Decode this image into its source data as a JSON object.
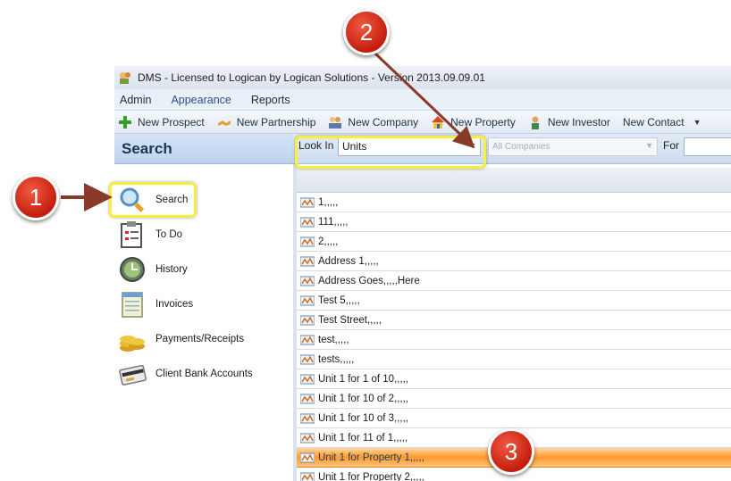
{
  "window": {
    "title": "DMS - Licensed to Logican by Logican Solutions - Version 2013.09.09.01"
  },
  "menu": [
    "Admin",
    "Appearance",
    "Reports"
  ],
  "toolbar": {
    "new_prospect": "New Prospect",
    "new_partnership": "New Partnership",
    "new_company": "New Company",
    "new_property": "New Property",
    "new_investor": "New Investor",
    "new_contact": "New Contact"
  },
  "left_panel": {
    "title": "Search",
    "items": [
      {
        "label": "Search",
        "icon": "magnifier-icon"
      },
      {
        "label": "To Do",
        "icon": "clipboard-icon"
      },
      {
        "label": "History",
        "icon": "clock-icon"
      },
      {
        "label": "Invoices",
        "icon": "notebook-icon"
      },
      {
        "label": "Payments/Receipts",
        "icon": "coins-icon"
      },
      {
        "label": "Client Bank Accounts",
        "icon": "credit-card-icon"
      }
    ]
  },
  "search_bar": {
    "look_in_label": "Look In",
    "look_in_value": "Units",
    "companies_value": "All Companies",
    "for_label": "For"
  },
  "results": [
    "1,,,,,",
    "111,,,,,",
    "2,,,,,",
    "Address 1,,,,,",
    "Address Goes,,,,,Here",
    "Test 5,,,,,",
    "Test Street,,,,,",
    "test,,,,,",
    "tests,,,,,",
    "Unit 1 for 1 of 10,,,,,",
    "Unit 1 for 10 of 2,,,,,",
    "Unit 1 for 10 of 3,,,,,",
    "Unit 1 for 11 of 1,,,,,",
    "Unit 1 for Property 1,,,,,",
    "Unit 1 for Property 2,,,,,"
  ],
  "selected_row": "Unit 1 for Property 1,,,,,",
  "callouts": {
    "one": "1",
    "two": "2",
    "three": "3"
  },
  "colors": {
    "highlight": "#f6f03a",
    "badge": "#d62a17",
    "selection": "#ff9a2e"
  }
}
